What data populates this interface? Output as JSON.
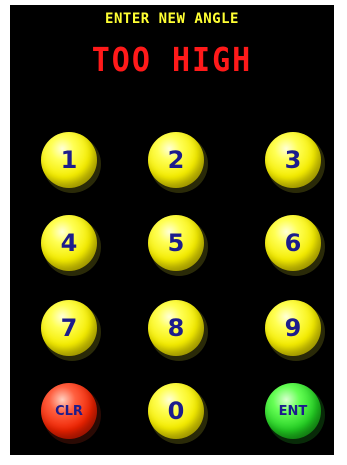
{
  "screen": {
    "prompt": "ENTER NEW ANGLE",
    "message": "TOO HIGH"
  },
  "keypad": {
    "key_1": "1",
    "key_2": "2",
    "key_3": "3",
    "key_4": "4",
    "key_5": "5",
    "key_6": "6",
    "key_7": "7",
    "key_8": "8",
    "key_9": "9",
    "key_0": "0",
    "clear": "CLR",
    "enter": "ENT"
  },
  "colors": {
    "background": "#000000",
    "prompt_text": "#ffff33",
    "message_text": "#ff1a1a",
    "digit_key": "#f4ec00",
    "clear_key": "#ee2200",
    "enter_key": "#22cc22",
    "key_label": "#1c1c8c"
  }
}
